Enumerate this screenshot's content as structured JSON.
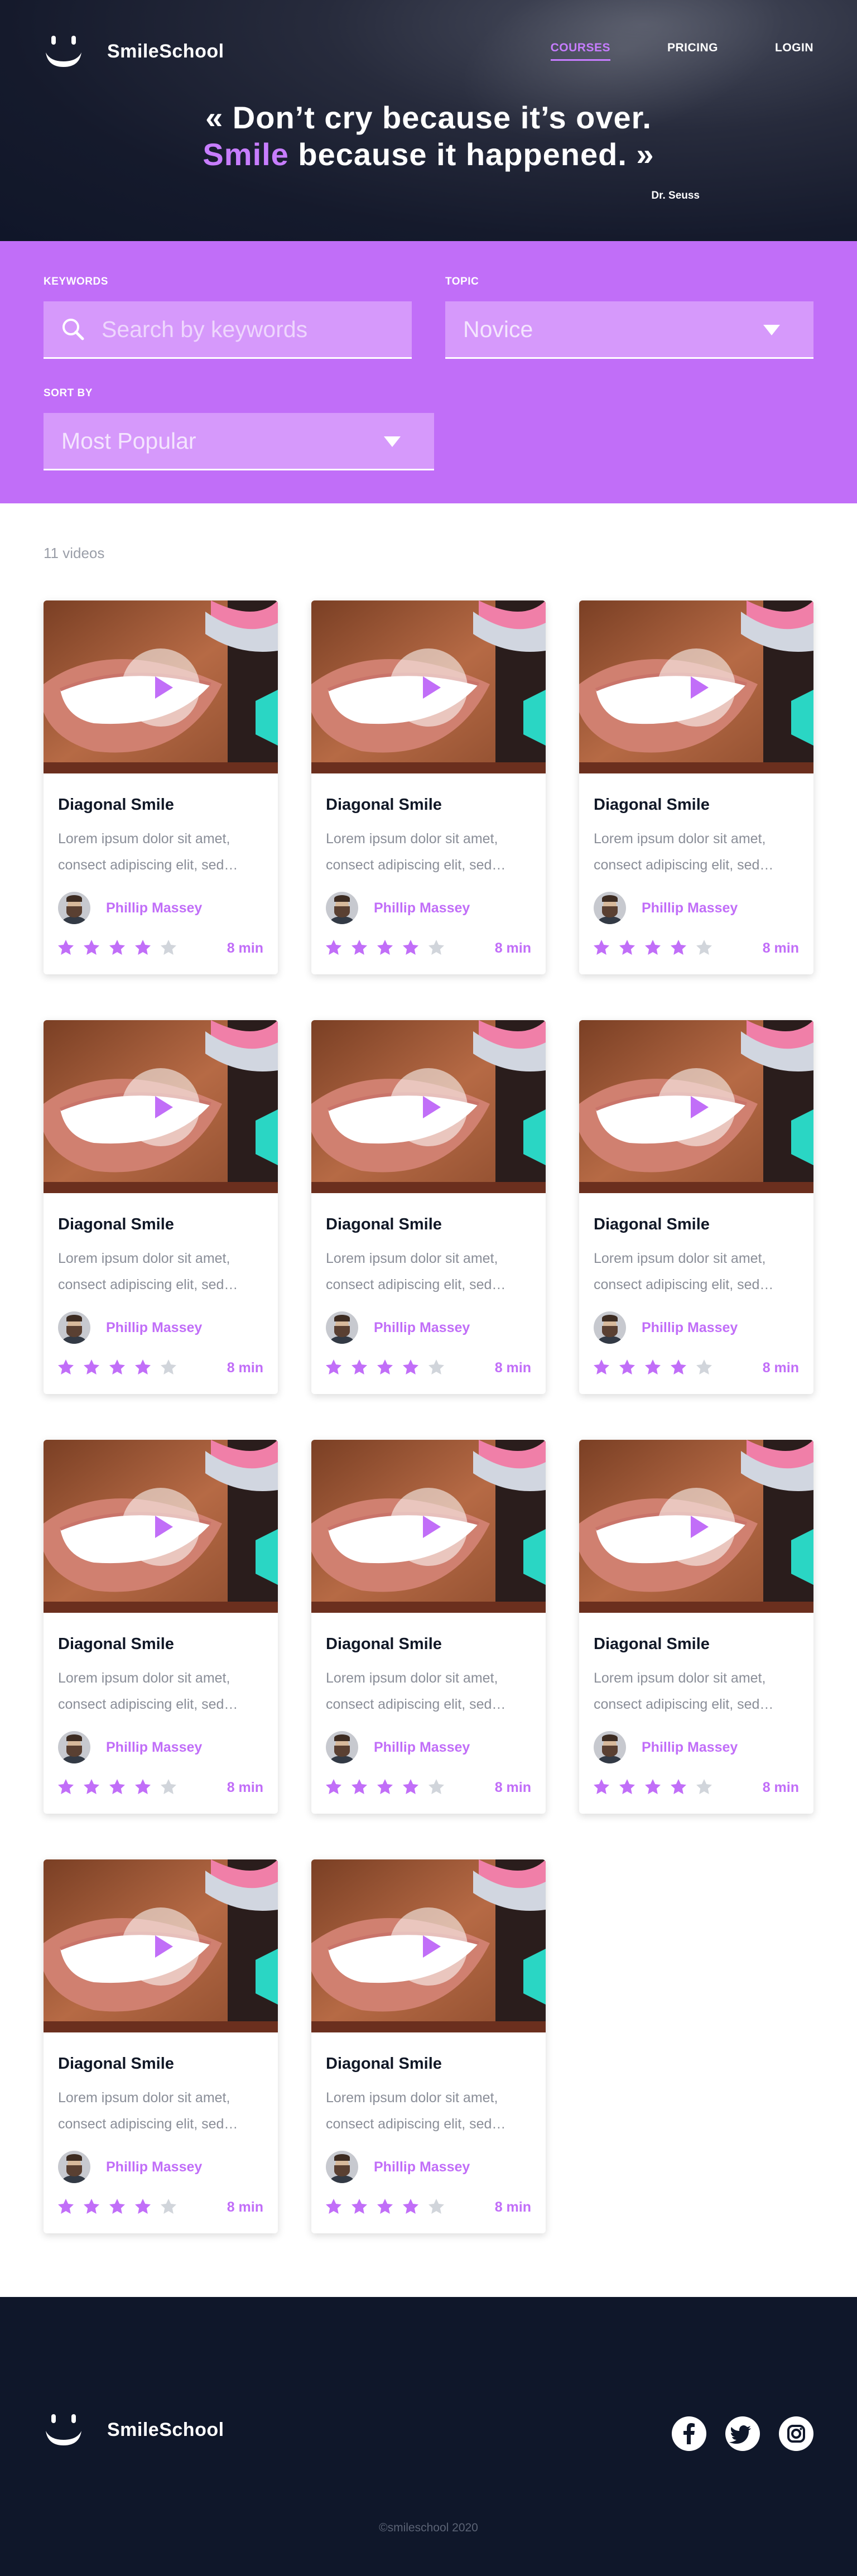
{
  "brand": {
    "name": "SmileSchool"
  },
  "nav": {
    "courses": "COURSES",
    "pricing": "PRICING",
    "login": "LOGIN"
  },
  "quote": {
    "line1": "« Don’t cry because it’s over.",
    "highlight": "Smile",
    "line2_rest": " because it happened. »",
    "author": "Dr. Seuss"
  },
  "filters": {
    "keywords_label": "KEYWORDS",
    "keywords_placeholder": "Search by keywords",
    "topic_label": "TOPIC",
    "topic_value": "Novice",
    "sort_label": "SORT BY",
    "sort_value": "Most Popular"
  },
  "results": {
    "count_text": "11 videos"
  },
  "videos": [
    {
      "title": "Diagonal Smile",
      "description": "Lorem ipsum dolor sit amet, consect adipiscing elit, sed…",
      "author": "Phillip Massey",
      "rating": 4,
      "duration": "8 min"
    },
    {
      "title": "Diagonal Smile",
      "description": "Lorem ipsum dolor sit amet, consect adipiscing elit, sed…",
      "author": "Phillip Massey",
      "rating": 4,
      "duration": "8 min"
    },
    {
      "title": "Diagonal Smile",
      "description": "Lorem ipsum dolor sit amet, consect adipiscing elit, sed…",
      "author": "Phillip Massey",
      "rating": 4,
      "duration": "8 min"
    },
    {
      "title": "Diagonal Smile",
      "description": "Lorem ipsum dolor sit amet, consect adipiscing elit, sed…",
      "author": "Phillip Massey",
      "rating": 4,
      "duration": "8 min"
    },
    {
      "title": "Diagonal Smile",
      "description": "Lorem ipsum dolor sit amet, consect adipiscing elit, sed…",
      "author": "Phillip Massey",
      "rating": 4,
      "duration": "8 min"
    },
    {
      "title": "Diagonal Smile",
      "description": "Lorem ipsum dolor sit amet, consect adipiscing elit, sed…",
      "author": "Phillip Massey",
      "rating": 4,
      "duration": "8 min"
    },
    {
      "title": "Diagonal Smile",
      "description": "Lorem ipsum dolor sit amet, consect adipiscing elit, sed…",
      "author": "Phillip Massey",
      "rating": 4,
      "duration": "8 min"
    },
    {
      "title": "Diagonal Smile",
      "description": "Lorem ipsum dolor sit amet, consect adipiscing elit, sed…",
      "author": "Phillip Massey",
      "rating": 4,
      "duration": "8 min"
    },
    {
      "title": "Diagonal Smile",
      "description": "Lorem ipsum dolor sit amet, consect adipiscing elit, sed…",
      "author": "Phillip Massey",
      "rating": 4,
      "duration": "8 min"
    },
    {
      "title": "Diagonal Smile",
      "description": "Lorem ipsum dolor sit amet, consect adipiscing elit, sed…",
      "author": "Phillip Massey",
      "rating": 4,
      "duration": "8 min"
    },
    {
      "title": "Diagonal Smile",
      "description": "Lorem ipsum dolor sit amet, consect adipiscing elit, sed…",
      "author": "Phillip Massey",
      "rating": 4,
      "duration": "8 min"
    }
  ],
  "footer": {
    "copyright": "©smileschool 2020",
    "socials": [
      "facebook-icon",
      "twitter-icon",
      "instagram-icon"
    ]
  },
  "colors": {
    "accent": "#c16ef8",
    "navy": "#0f172a",
    "star_off": "#d1d5db"
  }
}
